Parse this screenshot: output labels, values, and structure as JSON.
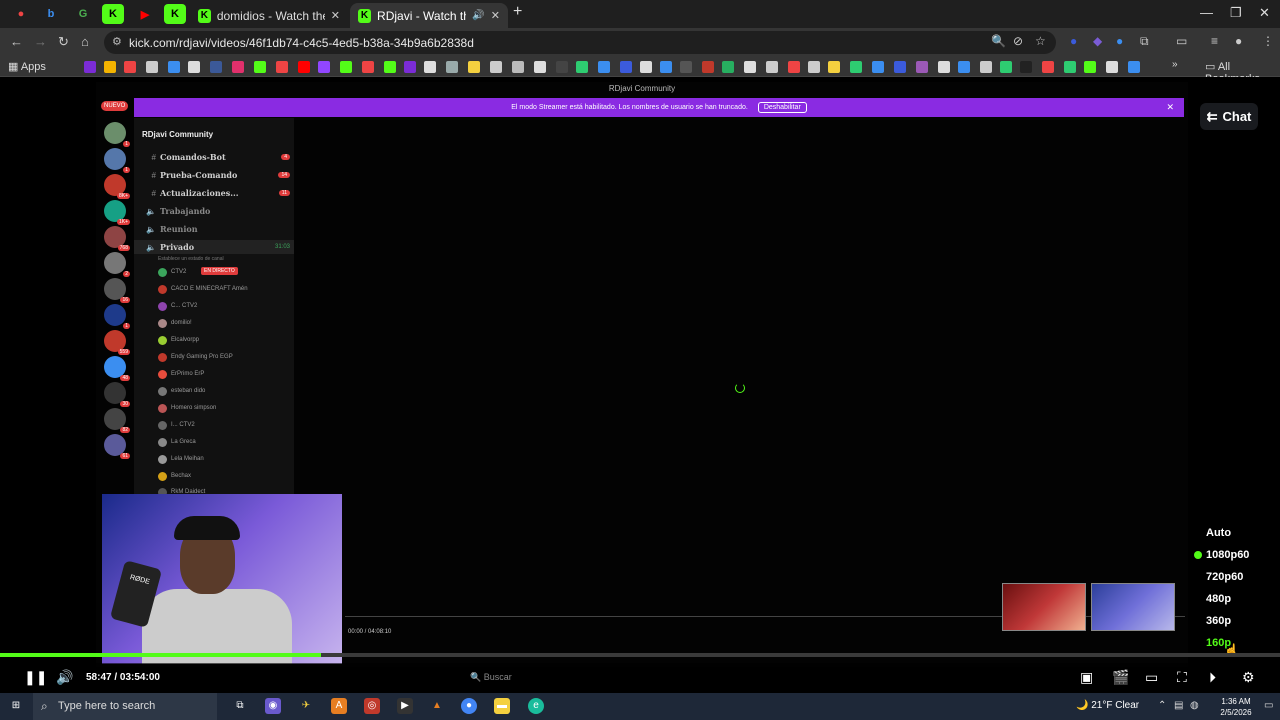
{
  "browser": {
    "tabs": [
      {
        "title": "domidios - Watch the VOD on",
        "active": false
      },
      {
        "title": "RDjavi - Watch the VOD on",
        "active": true
      }
    ],
    "new_tab": "+",
    "url": "kick.com/rdjavi/videos/46f1db74-c4c5-4ed5-b38a-34b9a6b2838d",
    "bookmarks_apps_label": "Apps",
    "all_bookmarks_label": "All Bookmarks"
  },
  "discord": {
    "window_title": "RDjavi Community",
    "nuevo_badge": "NUEVO",
    "streamer_banner": "El modo Streamer está habilitado. Los nombres de usuario se han truncado.",
    "disable_button": "Deshabilitar",
    "server_name": "RDjavi Community",
    "channels": [
      {
        "name": "Comandos-Bot",
        "count": "4"
      },
      {
        "name": "Prueba-Comando",
        "count": "14"
      },
      {
        "name": "Actualizaciones...",
        "count": "11"
      },
      {
        "name": "Trabajando",
        "count": ""
      },
      {
        "name": "Reunion",
        "count": ""
      },
      {
        "name": "Privado",
        "count": "31:03"
      }
    ],
    "channel_status": "Establece un estado de canal",
    "live_badge": "EN DIRECTO",
    "users": [
      "CTV2",
      "CACO E MINECRAFT  Amén",
      "C...  CTV2",
      "domilio!",
      "Elcalvorpp",
      "Endy Gaming Pro  EGP",
      "ErPrimo  ErP",
      "esteban dido",
      "Homero simpson",
      "I...  CTV2",
      "La Greca",
      "Lela Meihan",
      "Bechax",
      "RkM Daidect"
    ],
    "guild_badges": [
      "1",
      "1",
      "8K+",
      "1K+",
      "768",
      "2",
      "16",
      "1",
      "559",
      "48",
      "30",
      "82",
      "61"
    ],
    "mini_time": "00:00 / 04:08:10"
  },
  "chat_button": "Chat",
  "quality": {
    "options": [
      "Auto",
      "1080p60",
      "720p60",
      "480p",
      "360p",
      "160p"
    ],
    "current": "1080p60",
    "hovered": "160p"
  },
  "player": {
    "time": "58:47 / 03:54:00",
    "progress_fraction": 0.251,
    "inner_taskbar_search": "Buscar"
  },
  "taskbar": {
    "search_placeholder": "Type here to search",
    "weather": "21°F  Clear",
    "time": "1:36 AM",
    "date": "2/5/2026"
  },
  "colors": {
    "kick_green": "#53fc18",
    "discord_purple": "#8a2be2",
    "badge_red": "#e03c3c"
  }
}
